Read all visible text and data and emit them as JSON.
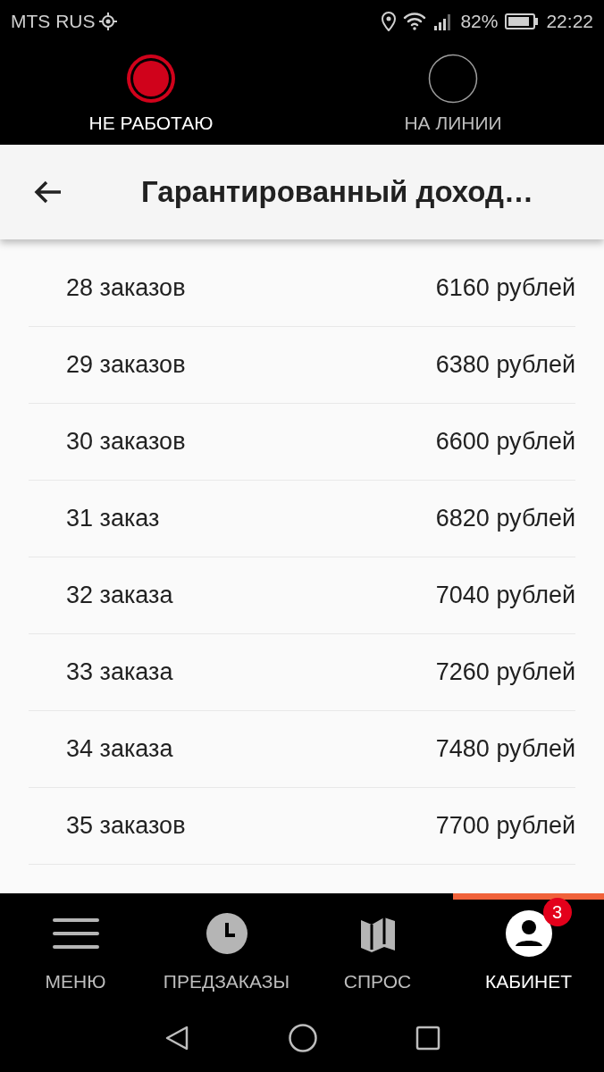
{
  "status_bar": {
    "carrier": "MTS RUS",
    "battery": "82%",
    "time": "22:22"
  },
  "work_status": [
    {
      "label": "НЕ РАБОТАЮ",
      "selected": true
    },
    {
      "label": "НА ЛИНИИ",
      "selected": false
    }
  ],
  "header": {
    "title": "Гарантированный доход…"
  },
  "rows": [
    {
      "orders": "28 заказов",
      "amount": "6160 рублей"
    },
    {
      "orders": "29 заказов",
      "amount": "6380 рублей"
    },
    {
      "orders": "30 заказов",
      "amount": "6600 рублей"
    },
    {
      "orders": "31 заказ",
      "amount": "6820 рублей"
    },
    {
      "orders": "32 заказа",
      "amount": "7040 рублей"
    },
    {
      "orders": "33 заказа",
      "amount": "7260 рублей"
    },
    {
      "orders": "34 заказа",
      "amount": "7480 рублей"
    },
    {
      "orders": "35 заказов",
      "amount": "7700 рублей"
    }
  ],
  "bottom_nav": [
    {
      "kind": "menu",
      "label": "МЕНЮ",
      "selected": false
    },
    {
      "kind": "clock",
      "label": "ПРЕДЗАКАЗЫ",
      "selected": false
    },
    {
      "kind": "map",
      "label": "СПРОС",
      "selected": false
    },
    {
      "kind": "profile",
      "label": "КАБИНЕТ",
      "selected": true,
      "badge": "3"
    }
  ]
}
